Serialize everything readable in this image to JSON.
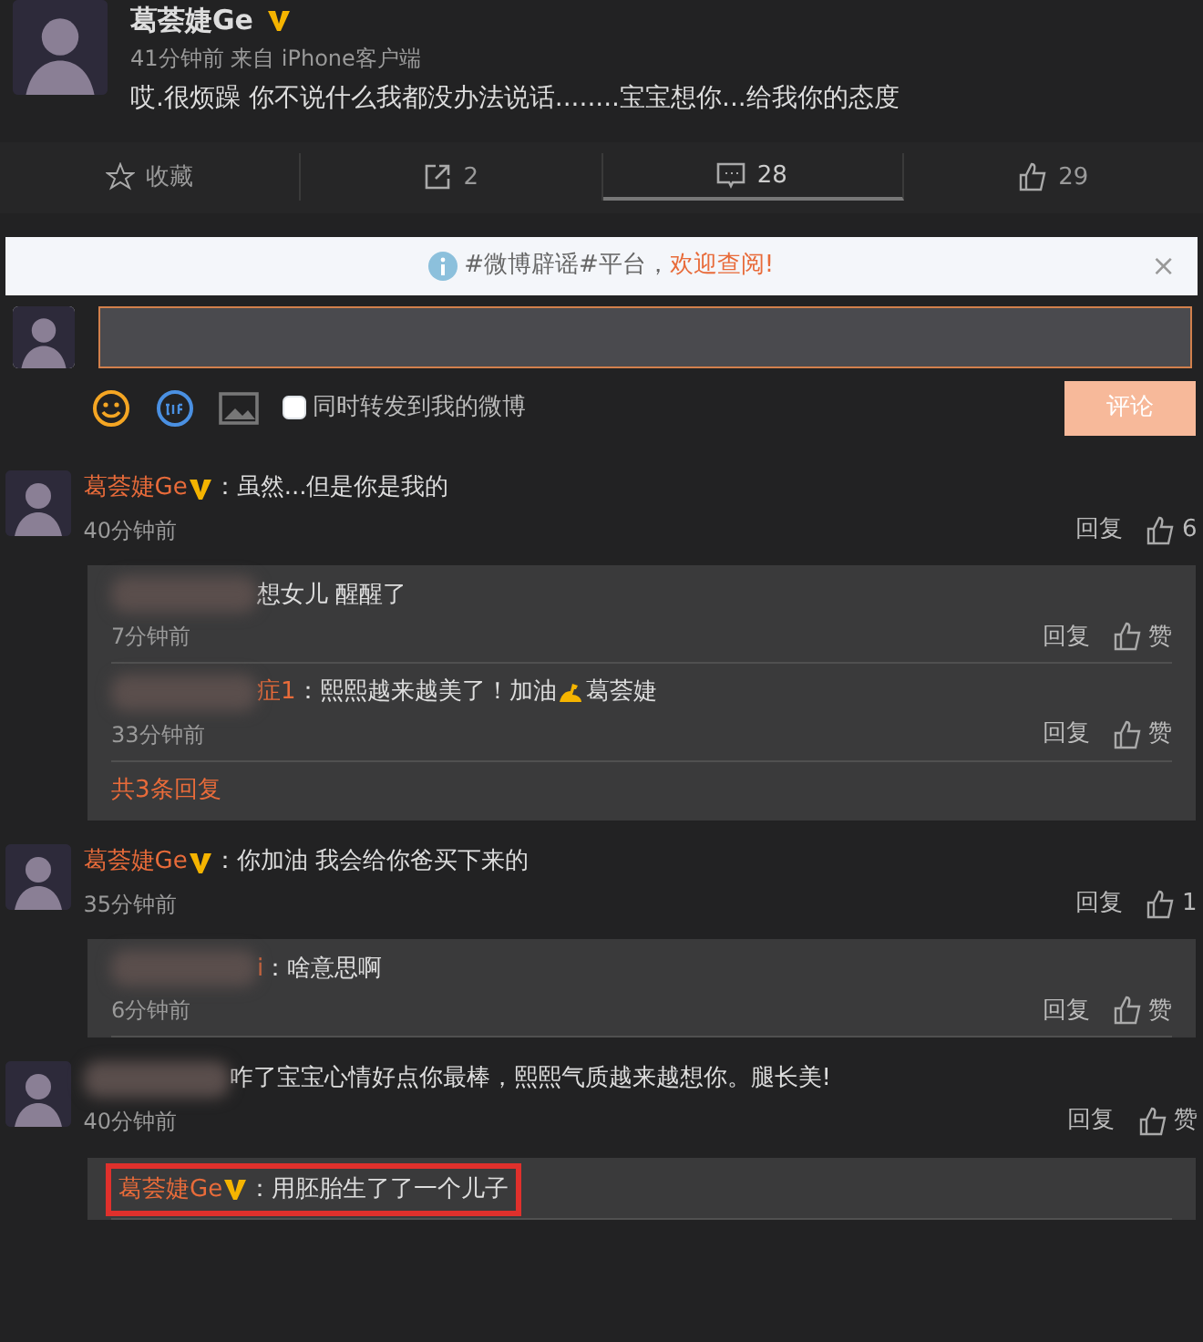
{
  "post": {
    "author": "葛荟婕Ge",
    "verified": true,
    "meta": "41分钟前 来自 iPhone客户端",
    "text": "哎.很烦躁 你不说什么我都没办法说话........宝宝想你...给我你的态度"
  },
  "actions": [
    {
      "kind": "favorite",
      "label": "收藏",
      "selected": false
    },
    {
      "kind": "repost",
      "label": "2",
      "selected": false
    },
    {
      "kind": "comment",
      "label": "28",
      "selected": true
    },
    {
      "kind": "like",
      "label": "29",
      "selected": false
    }
  ],
  "notice": {
    "text": "#微博辟谣#平台，",
    "link": "欢迎查阅!",
    "close": "×"
  },
  "composer": {
    "repost_label": "同时转发到我的微博",
    "repost_checked": false,
    "submit": "评论"
  },
  "comments": [
    {
      "name": "葛荟婕Ge",
      "blurred": false,
      "verified": true,
      "text": "：虽然...但是你是我的",
      "time": "40分钟前",
      "reply": "回复",
      "likes": "6",
      "replies": [
        {
          "blurred": true,
          "text": "想女儿 醒醒了",
          "time": "7分钟前",
          "reply": "回复",
          "like": "赞"
        },
        {
          "blurred": true,
          "name": "症1",
          "text": "：熙熙越来越美了！加油",
          "text_after": "葛荟婕",
          "time": "33分钟前",
          "reply": "回复",
          "like": "赞"
        }
      ],
      "more": "共3条回复"
    },
    {
      "name": "葛荟婕Ge",
      "blurred": false,
      "verified": true,
      "text": "：你加油 我会给你爸买下来的",
      "time": "35分钟前",
      "reply": "回复",
      "likes": "1",
      "replies": [
        {
          "blurred": true,
          "name": "i",
          "text": "：啥意思啊",
          "time": "6分钟前",
          "reply": "回复",
          "like": "赞"
        }
      ]
    },
    {
      "blurred": true,
      "verified": false,
      "text": "咋了宝宝心情好点你最棒，熙熙气质越来越想你。腿长美!",
      "time": "40分钟前",
      "reply": "回复",
      "like": "赞",
      "replies": [
        {
          "blurred": false,
          "name": "葛荟婕Ge",
          "verified": true,
          "text": "：用胚胎生了了一个儿子",
          "highlighted": true
        }
      ]
    }
  ]
}
